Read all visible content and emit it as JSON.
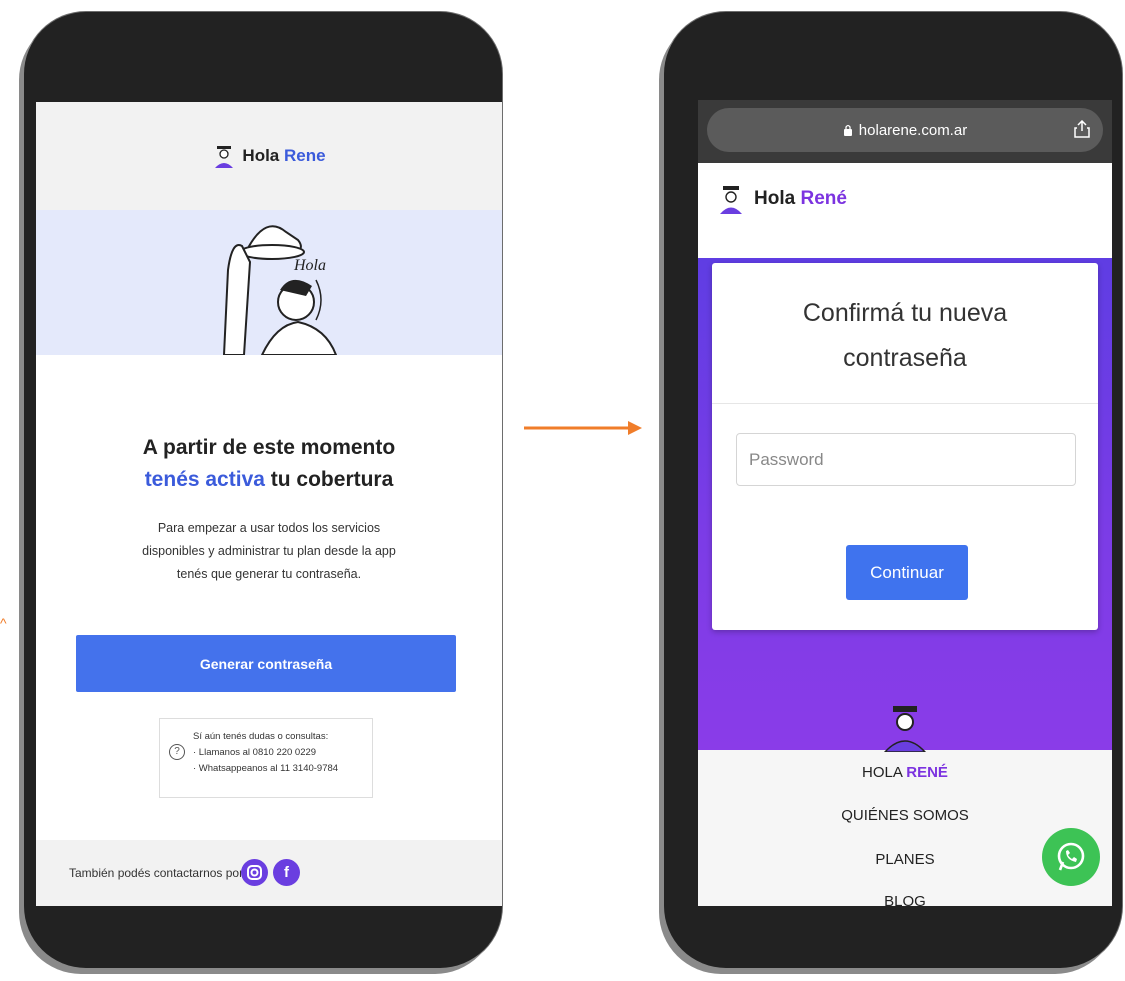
{
  "email": {
    "brand_prefix": "Hola",
    "brand_accent": "Rene",
    "title_line1": "A partir de este momento",
    "title_line2_blue": "tenés activa",
    "title_line2_rest": " tu cobertura",
    "body_line1": "Para empezar a usar todos los servicios",
    "body_line2": "disponibles y administrar tu plan desde la app",
    "body_line3": "tenés que generar tu contraseña.",
    "button_label": "Generar contraseña",
    "help_line1": "Sí aún tenés dudas o consultas:",
    "help_line2": "· Llamanos al 0810 220 0229",
    "help_line3": "· Whatsappeanos al 11 3140-9784",
    "footer_text": "También podés contactarnos por:",
    "hero_text": "Hola"
  },
  "web": {
    "url": "holarene.com.ar",
    "brand_prefix": "Hola",
    "brand_accent": "René",
    "card_title_line1": "Confirmá tu nueva",
    "card_title_line2": "contraseña",
    "password_placeholder": "Password",
    "continue_label": "Continuar",
    "footer_brand_prefix": "HOLA",
    "footer_brand_accent": "RENÉ",
    "nav_1": "QUIÉNES SOMOS",
    "nav_2": "PLANES",
    "nav_3": "BLOG"
  },
  "colors": {
    "arrow": "#f07d2a",
    "email_blue": "#4472ec",
    "web_purple": "#7c33e0",
    "whatsapp_green": "#3dc355"
  }
}
